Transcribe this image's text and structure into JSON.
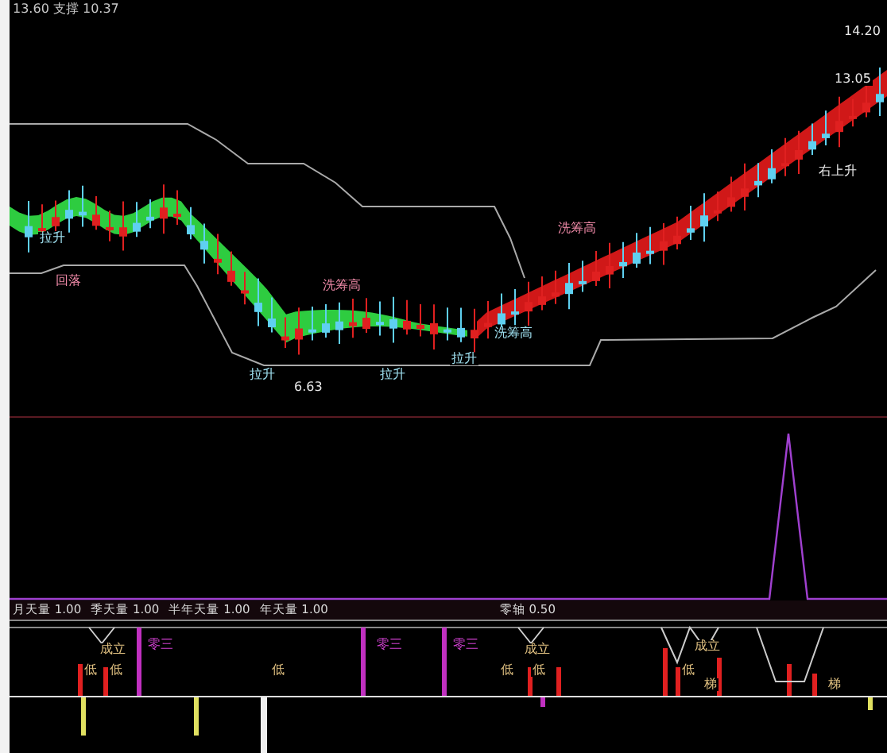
{
  "header": {
    "text": "13.60 支撑 10.37"
  },
  "main_annotations": [
    {
      "text": "拉升",
      "kind": "rise"
    },
    {
      "text": "回落",
      "kind": "warn"
    },
    {
      "text": "洗筹高",
      "kind": "warn"
    },
    {
      "text": "拉升",
      "kind": "rise"
    },
    {
      "text": "6.63",
      "kind": "price"
    },
    {
      "text": "拉升",
      "kind": "rise"
    },
    {
      "text": "拉升",
      "kind": "rise"
    },
    {
      "text": "洗筹高",
      "kind": "warn"
    },
    {
      "text": "洗筹高",
      "kind": "rise"
    },
    {
      "text": "右上升",
      "kind": "price"
    },
    {
      "text": "14.20",
      "kind": "price"
    },
    {
      "text": "13.05",
      "kind": "price"
    }
  ],
  "indicator": {
    "legend": [
      {
        "name": "月天量",
        "value": "1.00"
      },
      {
        "name": "季天量",
        "value": "1.00"
      },
      {
        "name": "半年天量",
        "value": "1.00"
      },
      {
        "name": "年天量",
        "value": "1.00"
      }
    ],
    "zero_axis": {
      "name": "零轴",
      "value": "0.50"
    },
    "signals": [
      {
        "text": "成立",
        "kind": "confirm"
      },
      {
        "text": "低",
        "kind": "low"
      },
      {
        "text": "低",
        "kind": "low"
      },
      {
        "text": "零三",
        "kind": "zero"
      },
      {
        "text": "低",
        "kind": "low"
      },
      {
        "text": "零三",
        "kind": "zero"
      },
      {
        "text": "零三",
        "kind": "zero"
      },
      {
        "text": "成立",
        "kind": "confirm"
      },
      {
        "text": "低",
        "kind": "low"
      },
      {
        "text": "低",
        "kind": "low"
      },
      {
        "text": "成立",
        "kind": "confirm"
      },
      {
        "text": "低",
        "kind": "low"
      },
      {
        "text": "梯",
        "kind": "confirm"
      },
      {
        "text": "梯",
        "kind": "confirm"
      }
    ]
  }
}
